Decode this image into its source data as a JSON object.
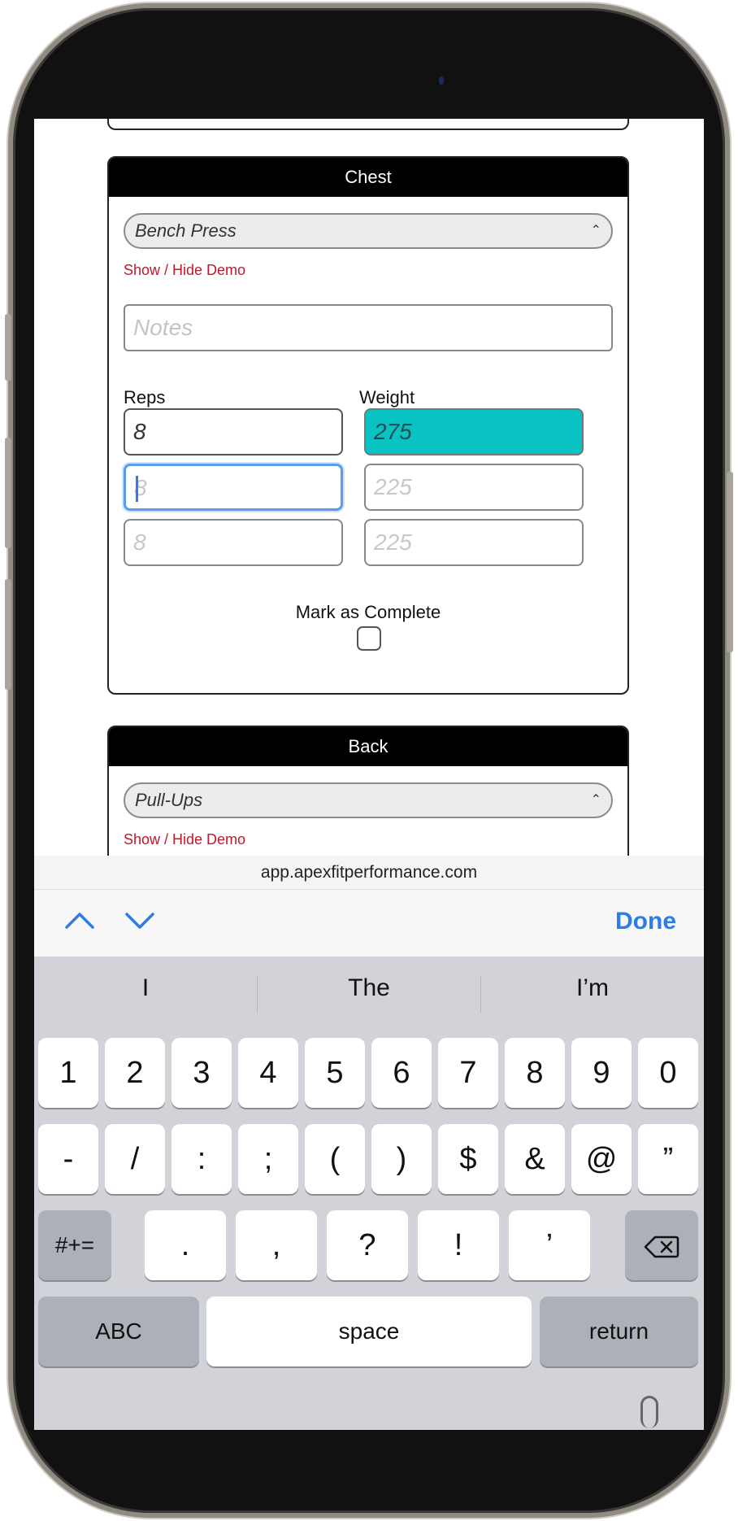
{
  "browser": {
    "url": "app.apexfitperformance.com"
  },
  "cards": [
    {
      "title": "Chest",
      "exercise": "Bench Press",
      "demo_link": "Show / Hide Demo",
      "notes_placeholder": "Notes",
      "reps_label": "Reps",
      "weight_label": "Weight",
      "sets": [
        {
          "reps": "8",
          "weight": "275",
          "reps_state": "filled",
          "weight_state": "highlighted"
        },
        {
          "reps": "8",
          "weight": "225",
          "reps_state": "placeholder-focused",
          "weight_state": "placeholder"
        },
        {
          "reps": "8",
          "weight": "225",
          "reps_state": "placeholder",
          "weight_state": "placeholder"
        }
      ],
      "complete_label": "Mark as Complete",
      "complete_checked": false
    },
    {
      "title": "Back",
      "exercise": "Pull-Ups",
      "demo_link": "Show / Hide Demo"
    }
  ],
  "accessory": {
    "prev_icon": "chevron-up-icon",
    "next_icon": "chevron-down-icon",
    "done_label": "Done"
  },
  "keyboard": {
    "suggestions": [
      "I",
      "The",
      "I’m"
    ],
    "row1": [
      "1",
      "2",
      "3",
      "4",
      "5",
      "6",
      "7",
      "8",
      "9",
      "0"
    ],
    "row2": [
      "-",
      "/",
      ":",
      ";",
      "(",
      ")",
      "$",
      "&",
      "@",
      "”"
    ],
    "row3": [
      "#+=",
      ".",
      ",",
      "?",
      "!",
      "’"
    ],
    "row3_delete_icon": "backspace-icon",
    "row4": {
      "abc": "ABC",
      "space": "space",
      "return": "return"
    }
  },
  "colors": {
    "accent": "#2f7ce6",
    "teal_field": "#08c2c4",
    "link_red": "#c0172b"
  }
}
